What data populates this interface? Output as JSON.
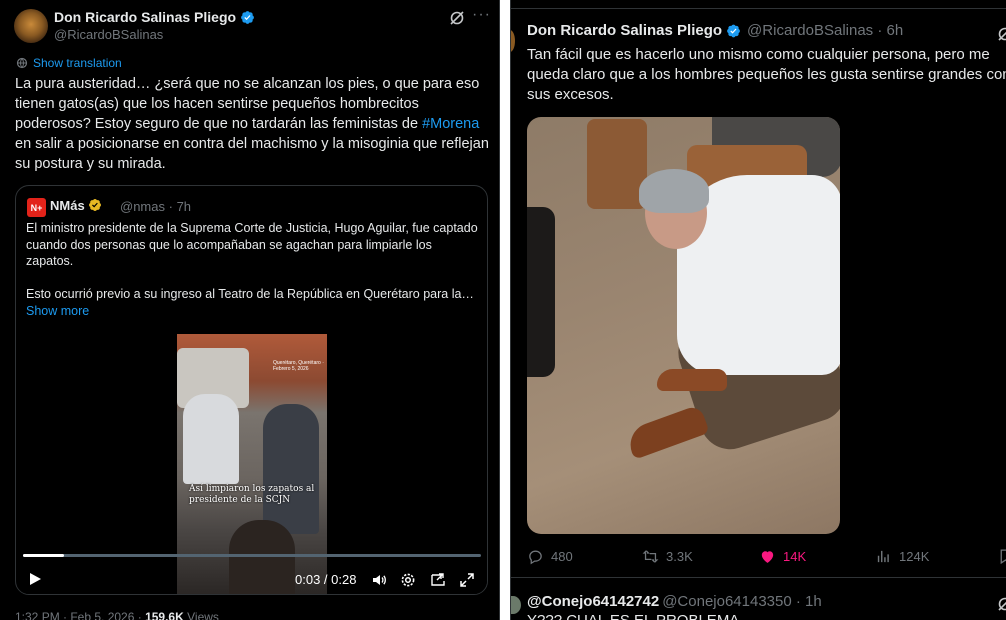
{
  "left_post": {
    "author_name": "Don Ricardo Salinas Pliego",
    "author_handle": "@RicardoBSalinas",
    "show_translation": "Show translation",
    "text_part1": "La pura austeridad… ¿será que no se alcanzan los pies, o que para eso tienen gatos(as) que los hacen sentirse pequeños hombrecitos poderosos? Estoy seguro de que no tardarán las feministas de ",
    "hashtag": "#Morena",
    "text_part2": " en salir a posicionarse en contra del machismo y la misoginia que reflejan su postura y su mirada.",
    "timestamp": "1:32 PM · Feb 5, 2026 · ",
    "views_count": "159.6K",
    "views_label": " Views"
  },
  "quoted_post": {
    "avatar_text": "N+",
    "author_name": "NMás",
    "author_handle": "@nmas",
    "time": "7h",
    "text": "El ministro presidente de la Suprema Corte de Justicia, Hugo Aguilar, fue captado cuando dos personas que lo acompañaban se agachan para limpiarle los zapatos.",
    "text2": "Esto ocurrió previo a su ingreso al Teatro de la República en Querétaro para la…",
    "show_more": "Show more",
    "video": {
      "caption": "Así limpiaron los zapatos al presidente de la SCJN",
      "small_caption": "Querétaro, Querétaro · Febrero 5, 2026",
      "time": "0:03 / 0:28",
      "progress": 0.09
    }
  },
  "right_post": {
    "author_name": "Don Ricardo Salinas Pliego",
    "author_handle": "@RicardoBSalinas",
    "time": "6h",
    "text": "Tan fácil que es hacerlo uno mismo como cualquier persona, pero me queda claro que a los hombres pequeños les gusta sentirse grandes con sus excesos.",
    "actions": {
      "replies": "480",
      "reposts": "3.3K",
      "likes": "14K",
      "views": "124K"
    }
  },
  "next_post": {
    "author_name": "@Conejo64142742",
    "author_handle": "@Conejo64143350",
    "time": "1h",
    "text": "Y??? CUAL ES EL PROBLEMA"
  },
  "colors": {
    "accent": "#1d9bf0",
    "like": "#f91880",
    "muted": "#71767b",
    "verified_gold": "#e8b923"
  }
}
